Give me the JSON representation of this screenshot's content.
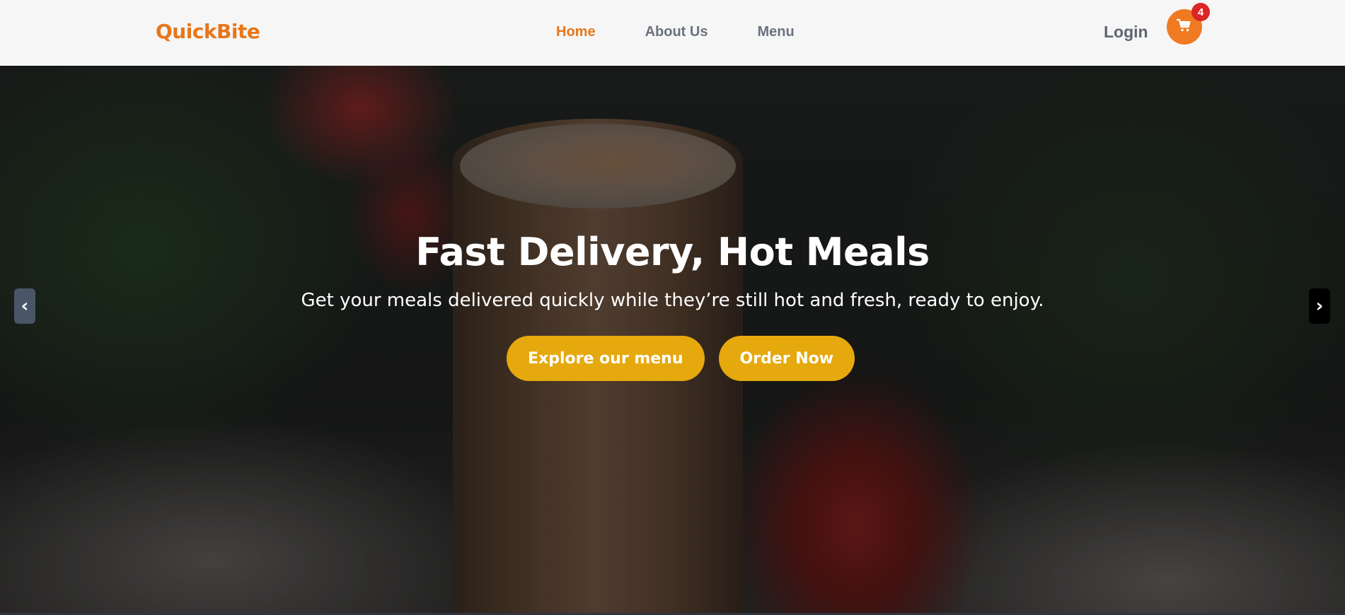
{
  "brand": {
    "name": "QuickBite",
    "accent_color": "#e8761a"
  },
  "nav": {
    "items": [
      {
        "label": "Home",
        "active": true
      },
      {
        "label": "About Us",
        "active": false
      },
      {
        "label": "Menu",
        "active": false
      }
    ]
  },
  "header": {
    "login_label": "Login",
    "cart_icon": "shopping-cart-icon",
    "cart_count": "4"
  },
  "hero": {
    "title": "Fast Delivery, Hot Meals",
    "subtitle": "Get your meals delivered quickly while they’re still hot and fresh, ready to enjoy.",
    "buttons": [
      {
        "label": "Explore our menu"
      },
      {
        "label": "Order Now"
      }
    ],
    "button_color": "#e6a90d",
    "prev_label": "‹",
    "next_label": "›"
  }
}
